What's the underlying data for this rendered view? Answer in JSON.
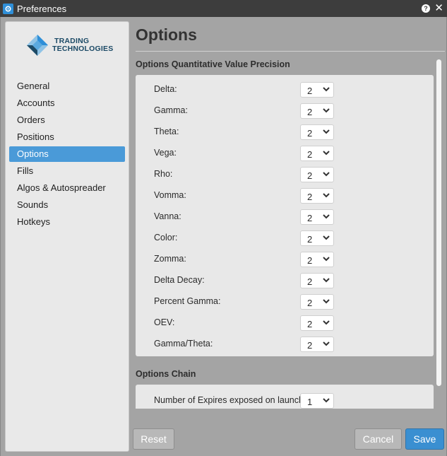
{
  "window": {
    "title": "Preferences",
    "help_glyph": "?",
    "close_glyph": "✕",
    "icons": [
      "app-icon",
      "help-icon",
      "close-icon"
    ]
  },
  "sidebar": {
    "logo_line1": "TRADING",
    "logo_line2": "TECHNOLOGIES",
    "items": [
      {
        "label": "General",
        "active": false
      },
      {
        "label": "Accounts",
        "active": false
      },
      {
        "label": "Orders",
        "active": false
      },
      {
        "label": "Positions",
        "active": false
      },
      {
        "label": "Options",
        "active": true
      },
      {
        "label": "Fills",
        "active": false
      },
      {
        "label": "Algos & Autospreader",
        "active": false
      },
      {
        "label": "Sounds",
        "active": false
      },
      {
        "label": "Hotkeys",
        "active": false
      }
    ]
  },
  "main": {
    "title": "Options",
    "precision_section": {
      "heading": "Options Quantitative Value Precision",
      "rows": [
        {
          "label": "Delta:",
          "value": "2"
        },
        {
          "label": "Gamma:",
          "value": "2"
        },
        {
          "label": "Theta:",
          "value": "2"
        },
        {
          "label": "Vega:",
          "value": "2"
        },
        {
          "label": "Rho:",
          "value": "2"
        },
        {
          "label": "Vomma:",
          "value": "2"
        },
        {
          "label": "Vanna:",
          "value": "2"
        },
        {
          "label": "Color:",
          "value": "2"
        },
        {
          "label": "Zomma:",
          "value": "2"
        },
        {
          "label": "Delta Decay:",
          "value": "2"
        },
        {
          "label": "Percent Gamma:",
          "value": "2"
        },
        {
          "label": "OEV:",
          "value": "2"
        },
        {
          "label": "Gamma/Theta:",
          "value": "2"
        }
      ]
    },
    "chain_section": {
      "heading": "Options Chain",
      "rows": [
        {
          "label": "Number of Expires exposed on launch:",
          "value": "1"
        }
      ]
    }
  },
  "footer": {
    "reset_label": "Reset",
    "cancel_label": "Cancel",
    "save_label": "Save"
  },
  "colors": {
    "accent": "#4a9ad8",
    "save_button": "#3a8fd1",
    "titlebar": "#3d3d3d"
  }
}
